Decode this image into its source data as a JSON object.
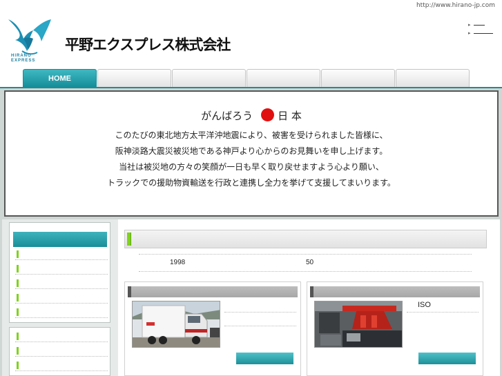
{
  "header": {
    "url": "http://www.hirano-jp.com",
    "company_name": "平野エクスプレス株式会社",
    "logo_text_line1": "HIRANO",
    "logo_text_line2": "EXPRESS",
    "top_links": [
      "",
      ""
    ]
  },
  "nav": {
    "tabs": [
      {
        "label": "HOME",
        "active": true
      },
      {
        "label": "",
        "active": false
      },
      {
        "label": "",
        "active": false
      },
      {
        "label": "",
        "active": false
      },
      {
        "label": "",
        "active": false
      },
      {
        "label": "",
        "active": false
      }
    ]
  },
  "message": {
    "title_left": "がんばろう",
    "title_right": "日 本",
    "lines": [
      "このたびの東北地方太平洋沖地震により、被害を受けられました皆様に、",
      "阪神淡路大震災被災地である神戸より心からのお見舞いを申し上げます。",
      "当社は被災地の方々の笑顔が一日も早く取り戻せますよう心より願い、",
      "トラックでの援助物資輸送を行政と連携し全力を挙げて支援してまいります。"
    ]
  },
  "main": {
    "info_year": "1998",
    "info_years": "50",
    "card2_label": "ISO"
  },
  "colors": {
    "accent": "#1a8e98",
    "marker": "#7fd21a",
    "red_dot": "#e01010"
  }
}
